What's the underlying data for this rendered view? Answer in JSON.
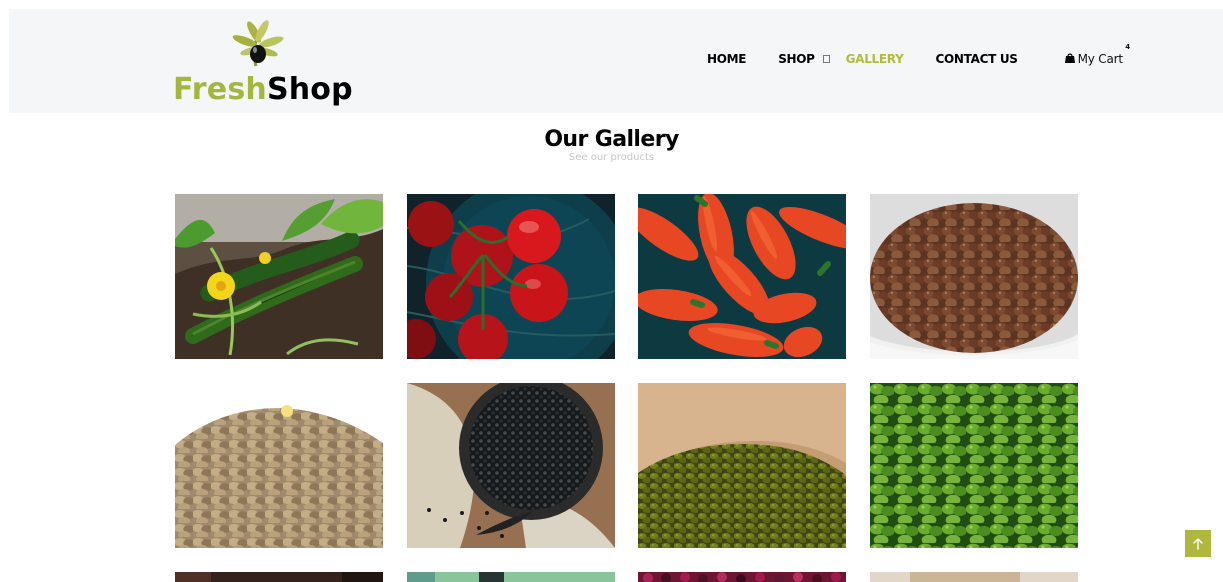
{
  "brand": {
    "name_part_1": "Fresh",
    "name_part_2": "Shop"
  },
  "nav": {
    "home": "HOME",
    "shop": "SHOP",
    "gallery": "GALLERY",
    "contact": "CONTACT US",
    "cart": "My Cart",
    "cart_count": "4"
  },
  "gallery": {
    "title": "Our Gallery",
    "subtitle": "See our products",
    "items": [
      "cucumber plants",
      "red tomatoes",
      "red peppers",
      "brown lentils",
      "beige lentils",
      "black seeds",
      "mung beans",
      "green mung beans",
      "dark product",
      "green product",
      "red beans",
      "beige product"
    ]
  },
  "colors": {
    "accent": "#b0bd3c",
    "header_bg": "#f5f6f7",
    "scroll_button": "#aeb83f"
  },
  "icons": {
    "cart": "shopping-bag-icon",
    "scroll_top": "arrow-up-icon",
    "logo": "olive-branch-icon"
  }
}
